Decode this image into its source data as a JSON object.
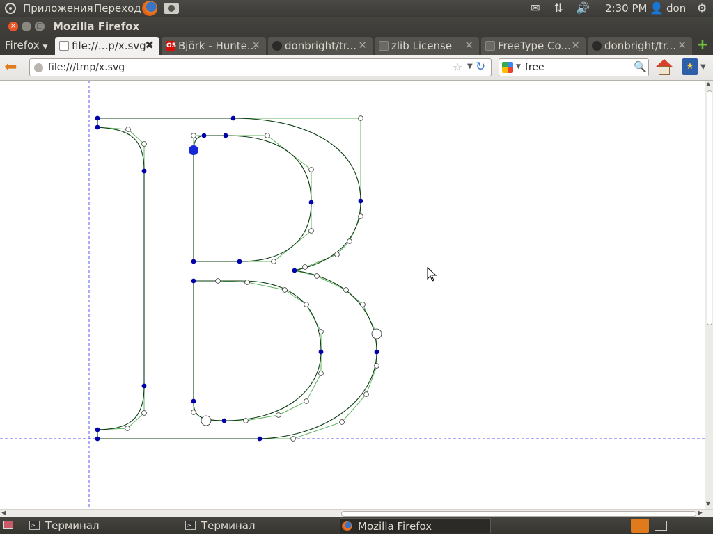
{
  "top_panel": {
    "apps_menu": "Приложения",
    "places_menu": "Переход",
    "clock": "2:30 PM",
    "user": "don"
  },
  "window": {
    "title": "Mozilla Firefox"
  },
  "tabbar": {
    "firefox_menu": "Firefox",
    "tabs": [
      {
        "label": "file://...p/x.svg",
        "icon": "blank-page-icon",
        "active": true
      },
      {
        "label": "Björk - Hunte...",
        "icon": "lastfm-icon",
        "active": false
      },
      {
        "label": "donbright/tr...",
        "icon": "github-icon",
        "active": false
      },
      {
        "label": "zlib License",
        "icon": "blank-page-icon",
        "active": false
      },
      {
        "label": "FreeType Co...",
        "icon": "blank-page-icon",
        "active": false
      },
      {
        "label": "donbright/tr...",
        "icon": "github-icon",
        "active": false
      }
    ],
    "lastfm_icon_text": "OS",
    "new_tab_icon": "+"
  },
  "navbar": {
    "url": "file:///tmp/x.svg",
    "search_value": "free"
  },
  "taskbar": {
    "tasks": [
      {
        "label": "Терминал",
        "icon": "terminal-icon"
      },
      {
        "label": "Терминал",
        "icon": "terminal-icon"
      },
      {
        "label": "Mozilla Firefox",
        "icon": "firefox-icon",
        "active": true
      }
    ]
  },
  "glyph": {
    "outline_color": "#0b3d12",
    "control_polygon_color": "#5fb35f",
    "on_curve_point_color": "#0000aa",
    "guide_color": "#5a5af0"
  }
}
